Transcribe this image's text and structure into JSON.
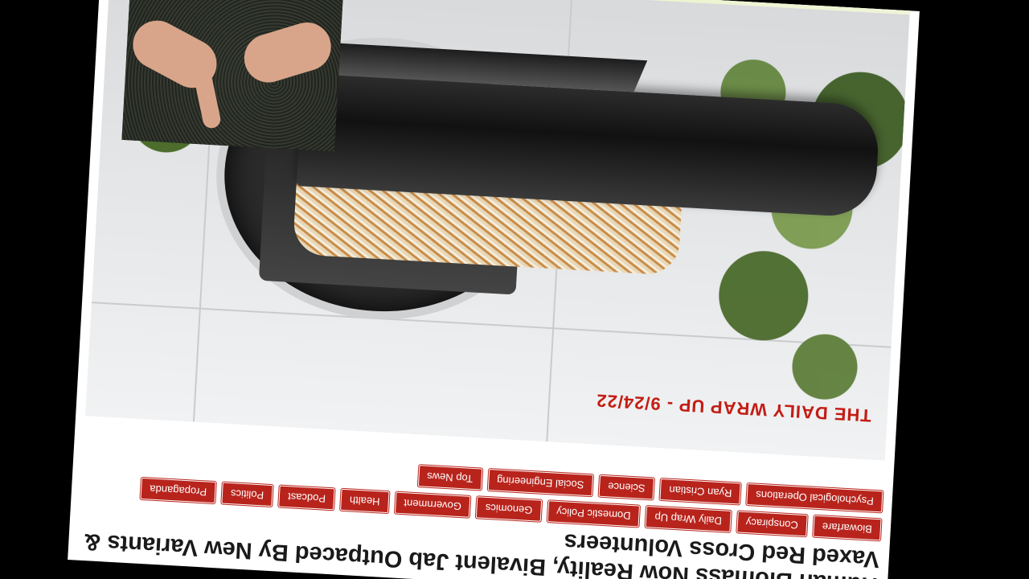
{
  "article": {
    "headline": "Human Biomass Now Reality, Bivalent Jab Outpaced By New Variants & Vaxed Red Cross Volunteers"
  },
  "tags": [
    "Biowarfare",
    "Conspiracy",
    "Daily Wrap Up",
    "Domestic Policy",
    "Genomics",
    "Government",
    "Health",
    "Podcast",
    "Politics",
    "Propaganda",
    "Psychological Operations",
    "Ryan Cristian",
    "Science",
    "Social Engineering",
    "Top News"
  ],
  "hero": {
    "caption": "THE DAILY WRAP UP - 9/24/22"
  }
}
